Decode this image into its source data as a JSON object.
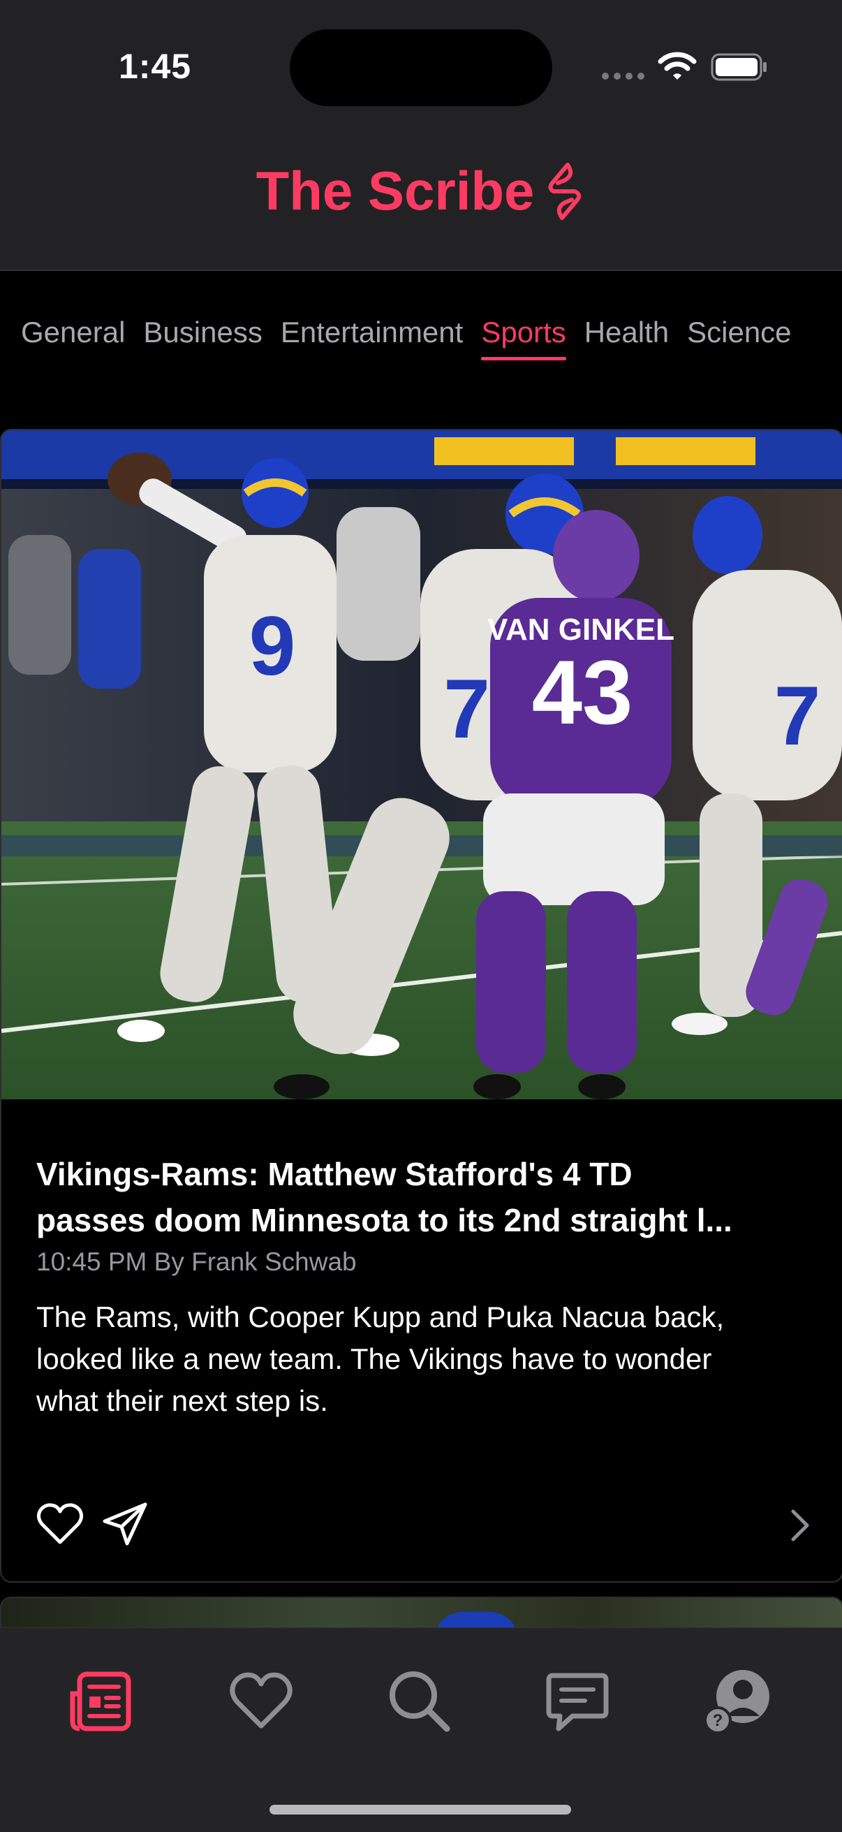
{
  "status_bar": {
    "time": "1:45"
  },
  "header": {
    "title": "The Scribe"
  },
  "categories": {
    "items": [
      "General",
      "Business",
      "Entertainment",
      "Sports",
      "Health",
      "Science"
    ],
    "active": "Sports"
  },
  "article": {
    "headline_line1": "Vikings-Rams: Matthew Stafford's 4 TD",
    "headline_line2": "passes doom Minnesota to its 2nd straight l...",
    "meta": "10:45 PM By Frank Schwab",
    "summary_line1": "The Rams, with Cooper Kupp and Puka Nacua back,",
    "summary_line2": "looked like a new team. The Vikings have to wonder",
    "summary_line3": "what their next step is."
  },
  "tabbar": {
    "tabs": [
      "news-icon",
      "heart-icon",
      "search-icon",
      "chat-icon",
      "profile-icon"
    ],
    "active": "news-icon"
  },
  "colors": {
    "accent": "#ff3b62",
    "background": "#000000",
    "bar": "#222224"
  }
}
